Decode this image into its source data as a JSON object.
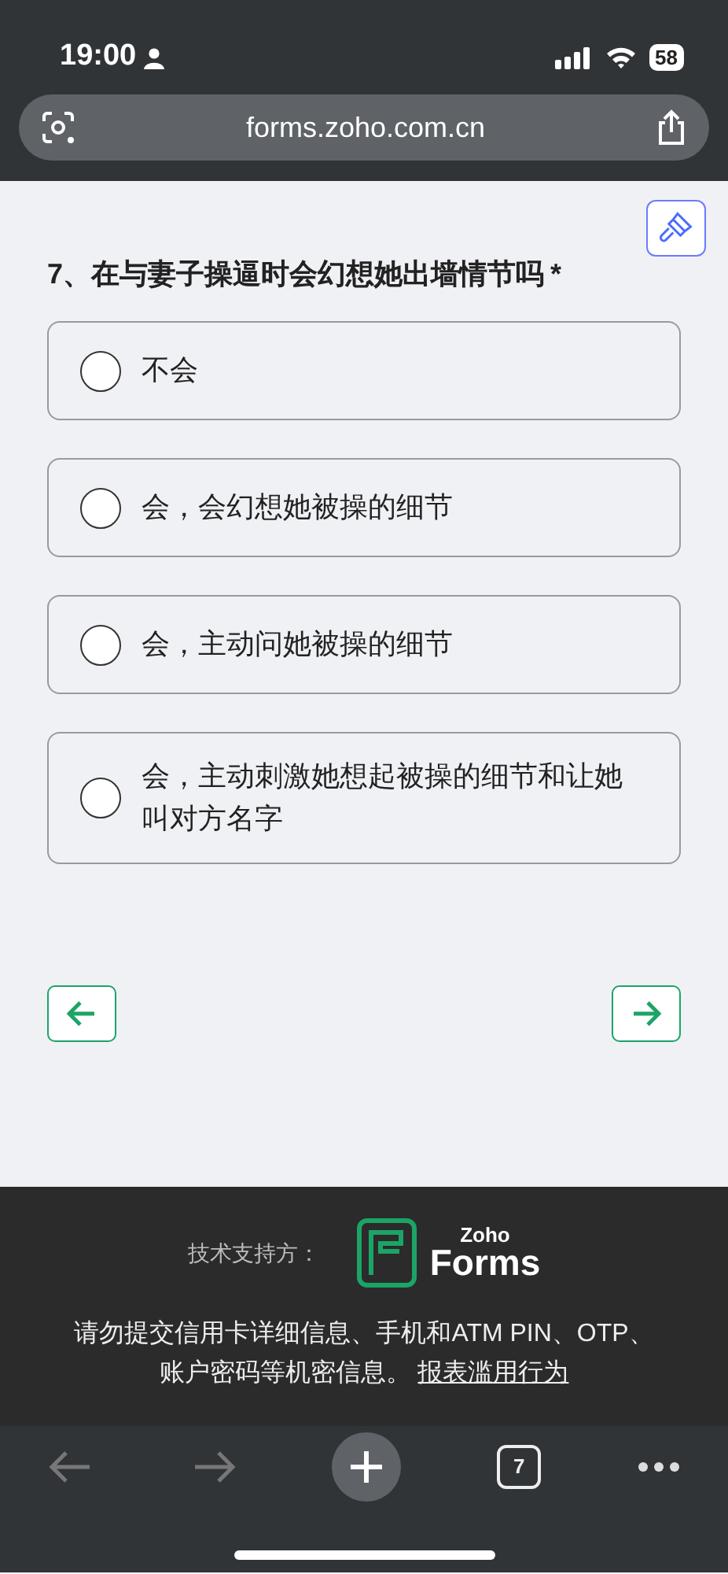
{
  "status_bar": {
    "time": "19:00",
    "battery": "58"
  },
  "address_bar": {
    "url": "forms.zoho.com.cn"
  },
  "question": {
    "text": "7、在与妻子操逼时会幻想她出墙情节吗",
    "required_mark": "*"
  },
  "options": [
    {
      "label": "不会",
      "selected": false
    },
    {
      "label": "会，会幻想她被操的细节",
      "selected": false
    },
    {
      "label": "会，主动问她被操的细节",
      "selected": false
    },
    {
      "label": "会，主动刺激她想起被操的细节和让她叫对方名字",
      "selected": false
    }
  ],
  "footer": {
    "powered_by": "技术支持方：",
    "logo_top": "Zoho",
    "logo_bottom": "Forms",
    "notice": "请勿提交信用卡详细信息、手机和ATM PIN、OTP、账户密码等机密信息。",
    "report_link": "报表滥用行为"
  },
  "toolbar": {
    "tab_count": "7"
  }
}
